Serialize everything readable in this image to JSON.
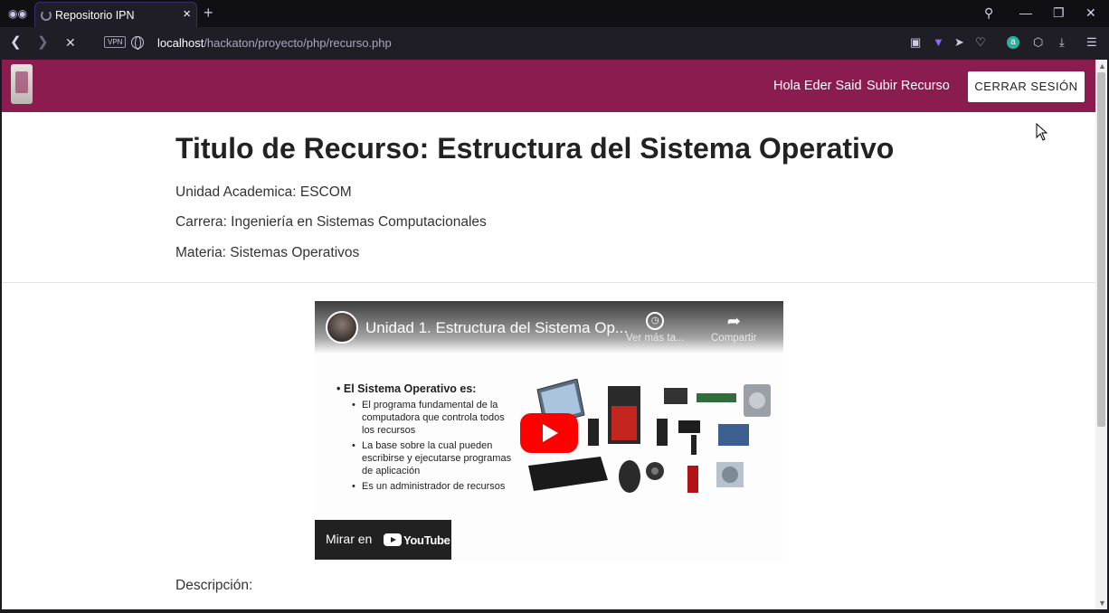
{
  "browser": {
    "tab_title": "Repositorio IPN",
    "url_host": "localhost",
    "url_path": "/hackaton/proyecto/php/recurso.php",
    "vpn_label": "VPN"
  },
  "header": {
    "greeting": "Hola Eder Said",
    "upload_link": "Subir Recurso",
    "logout_button": "CERRAR SESIÓN"
  },
  "resource": {
    "title": "Titulo de Recurso: Estructura del Sistema Operativo",
    "unidad": "Unidad Academica: ESCOM",
    "carrera": "Carrera: Ingeniería en Sistemas Computacionales",
    "materia": "Materia: Sistemas Operativos",
    "description_label": "Descripción:"
  },
  "video": {
    "title": "Unidad 1. Estructura del Sistema Op...",
    "watch_later": "Ver más ta...",
    "share": "Compartir",
    "watch_on": "Mirar en",
    "yt_brand": "YouTube",
    "slide_heading": "El Sistema Operativo es:",
    "slide_bullets": [
      "El programa fundamental de la computadora que controla todos los recursos",
      "La base sobre la cual pueden escribirse y ejecutarse programas de aplicación",
      "Es un administrador de recursos"
    ]
  },
  "colors": {
    "header_bg": "#8a1c4f",
    "youtube_red": "#ff0000"
  }
}
